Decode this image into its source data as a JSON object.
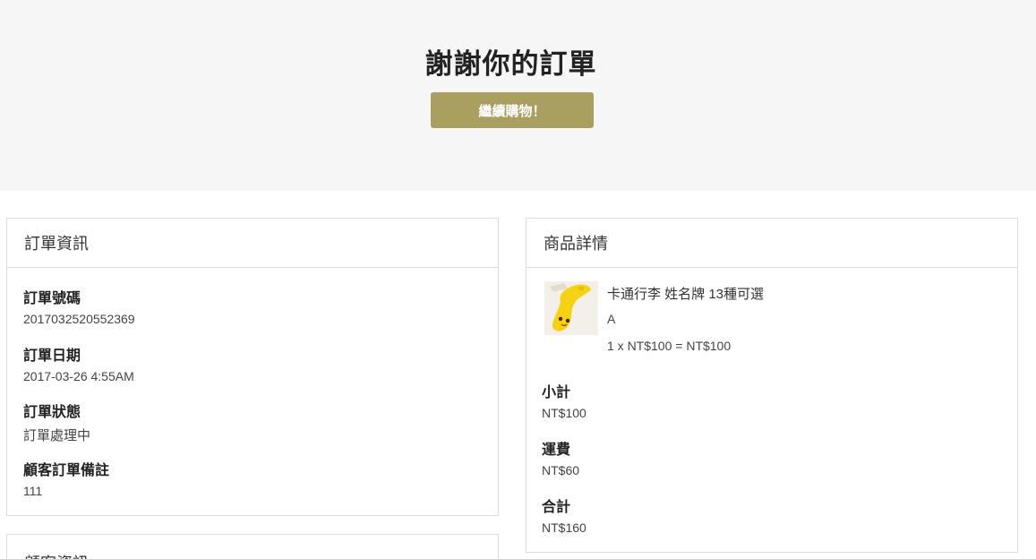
{
  "hero": {
    "title": "謝謝你的訂單",
    "continue_label": "繼續購物！"
  },
  "order_info": {
    "heading": "訂單資訊",
    "fields": [
      {
        "label": "訂單號碼",
        "value": "2017032520552369"
      },
      {
        "label": "訂單日期",
        "value": "2017-03-26 4:55AM"
      },
      {
        "label": "訂單狀態",
        "value": "訂單處理中"
      },
      {
        "label": "顧客訂單備註",
        "value": "111"
      }
    ]
  },
  "customer_info": {
    "heading": "顧客資訊"
  },
  "product_details": {
    "heading": "商品詳情",
    "item": {
      "name": "卡通行李 姓名牌 13種可選",
      "variant": "A",
      "qty_line": "1 x NT$100 = NT$100",
      "thumb_icon": "yellow-luggage-tag-image"
    },
    "summary": [
      {
        "label": "小計",
        "value": "NT$100"
      },
      {
        "label": "運費",
        "value": "NT$60"
      },
      {
        "label": "合計",
        "value": "NT$160"
      }
    ]
  },
  "colors": {
    "accent": "#a99f61",
    "hero_bg": "#f6f6f6",
    "border": "#dddddd"
  }
}
